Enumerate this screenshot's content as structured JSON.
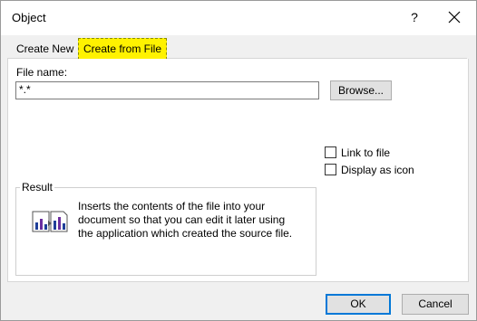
{
  "window": {
    "title": "Object",
    "help_glyph": "?"
  },
  "tabs": [
    {
      "label": "Create New",
      "active": false
    },
    {
      "label": "Create from File",
      "active": true,
      "highlight": "#fff200"
    }
  ],
  "file": {
    "label": "File name:",
    "value": "*.*",
    "browse_label": "Browse..."
  },
  "options": [
    {
      "label": "Link to file",
      "checked": false
    },
    {
      "label": "Display as icon",
      "checked": false
    }
  ],
  "result": {
    "legend": "Result",
    "text": "Inserts the contents of the file into your document so that you can edit it later using the application which created the source file."
  },
  "buttons": {
    "ok": "OK",
    "cancel": "Cancel"
  },
  "colors": {
    "accent": "#0078d7",
    "highlight": "#fff200"
  },
  "icons": [
    "close-icon",
    "document-chart-icon"
  ]
}
